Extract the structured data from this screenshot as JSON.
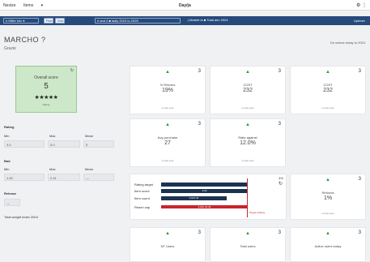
{
  "topbar": {
    "left_items": [
      "Nextze",
      "Items",
      "▾"
    ],
    "center_title": "Day/ja",
    "right_items": [
      "⚙",
      "⋮"
    ]
  },
  "toolbar": {
    "pills": [
      "# Miller Inlc ▾",
      "Pick",
      "Sort",
      "# and 2 ■ ladly 2024 to 2025",
      "| Market to ■ Total ann 2024"
    ],
    "right_link": "Upinner"
  },
  "page": {
    "heading": "MARCHO ? ",
    "subheading": "Grazie",
    "right_link": "Do unless today to 2024"
  },
  "score_card": {
    "label": "Overall score",
    "value": "5",
    "stars": "★★★★★",
    "foot": "Rating",
    "icon": "↻"
  },
  "filters": {
    "group1": {
      "label": "Rating",
      "cols": [
        "Min",
        "Max",
        "Mean"
      ],
      "values": [
        "4.0",
        "5.0",
        "5"
      ]
    },
    "group2": {
      "label": "Bad",
      "cols": [
        "Min",
        "Max",
        "Mean"
      ],
      "values": [
        "1.40",
        "2.41",
        "—"
      ]
    },
    "group3": {
      "label": "Release",
      "values": [
        "—"
      ]
    },
    "footer": "Total weight index 2004"
  },
  "cards": [
    {
      "num": "3",
      "label": "% Returns",
      "value": "19%",
      "foot": "vs last year"
    },
    {
      "num": "3",
      "label": "COST",
      "value": "232",
      "foot": "vs last year"
    },
    {
      "num": "3",
      "label": "COST",
      "value": "232",
      "foot": "vs last year"
    },
    {
      "num": "3",
      "label": "Avg purchase",
      "value": "27",
      "foot": "vs last year"
    },
    {
      "num": "3",
      "label": "Ratio against",
      "value": "12.0%",
      "foot": "vs last year"
    },
    {
      "num": "3",
      "label": "Refunds",
      "value": "1%",
      "foot": "vs last year"
    },
    {
      "num": "3",
      "label": "NT Users",
      "value": "",
      "foot": ""
    },
    {
      "num": "3",
      "label": "Total users",
      "value": "",
      "foot": ""
    },
    {
      "num": "3",
      "label": "Active users today",
      "value": "",
      "foot": ""
    }
  ],
  "bar_card": {
    "num": "4%",
    "icon": "↻",
    "rows": [
      {
        "label": "Rating target",
        "value": 0.72,
        "text": "",
        "color": "#1c3350"
      },
      {
        "label": "Item score",
        "value": 0.72,
        "text": "3,03",
        "color": "#1c3350"
      },
      {
        "label": "Item count",
        "value": 0.55,
        "text": "3,021 34",
        "color": "#1c3350"
      },
      {
        "label": "Reach cap",
        "value": 0.72,
        "text": "3,021 34 34",
        "color": "#c9242c"
      }
    ],
    "marker_text": "Target ranking"
  }
}
